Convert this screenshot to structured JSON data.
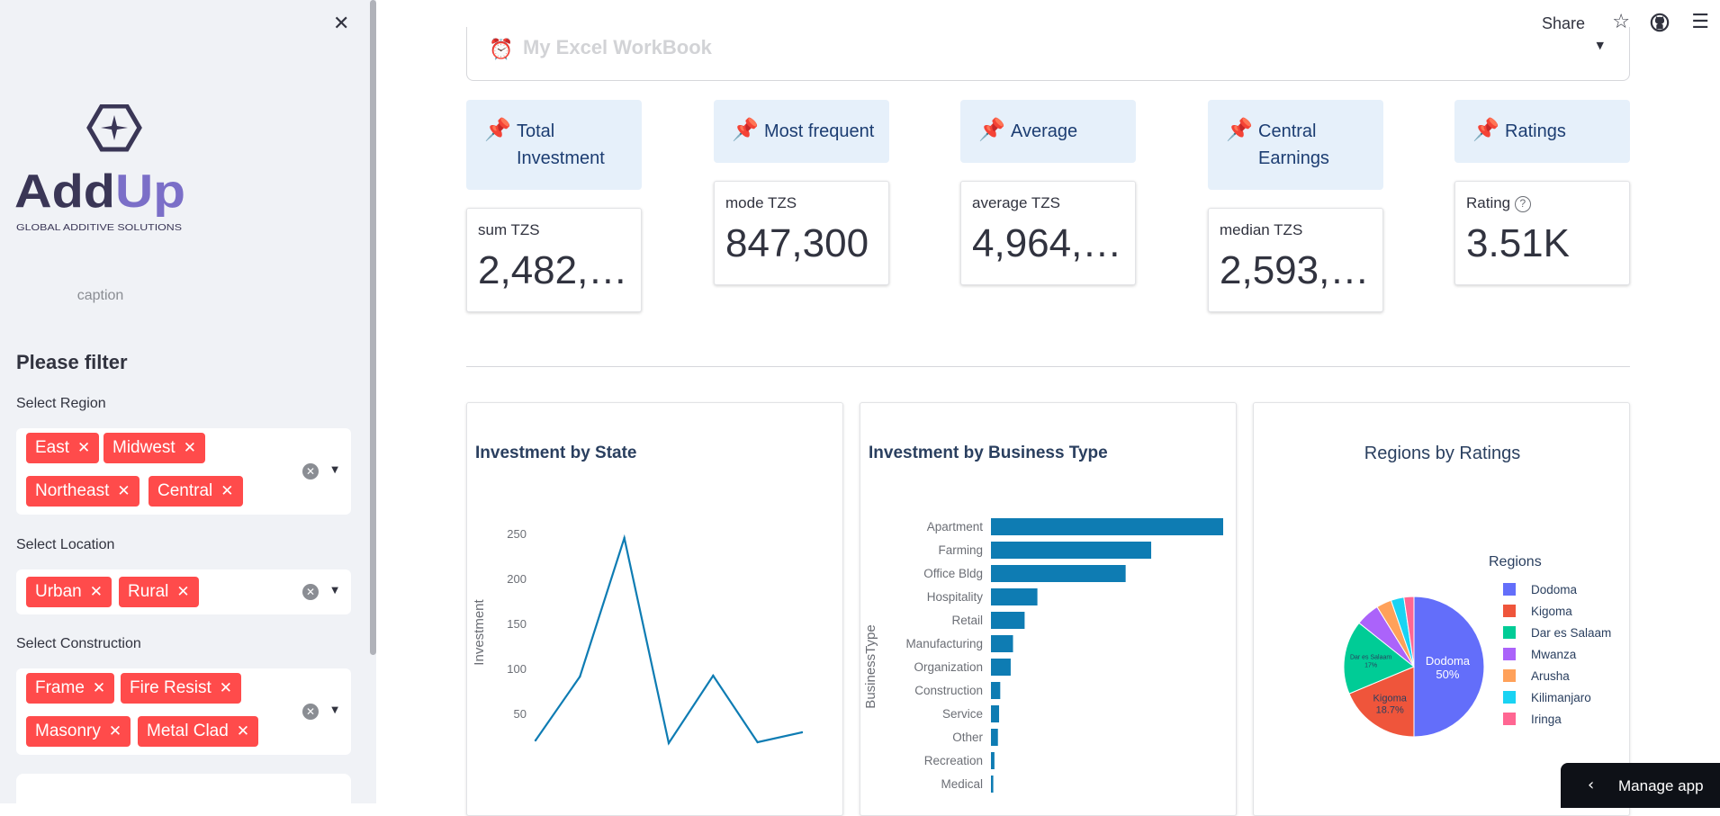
{
  "sidebar": {
    "close_icon": "close-icon",
    "logo": {
      "name": "AddUp",
      "tagline": "GLOBAL ADDITIVE SOLUTIONS",
      "accent": "#7b6fc8",
      "dark": "#3a3656"
    },
    "caption": "caption",
    "filter_heading": "Please filter",
    "filters": [
      {
        "label": "Select Region",
        "chips": [
          "East",
          "Midwest",
          "Northeast",
          "Central"
        ]
      },
      {
        "label": "Select Location",
        "chips": [
          "Urban",
          "Rural"
        ]
      },
      {
        "label": "Select Construction",
        "chips": [
          "Frame",
          "Fire Resist",
          "Masonry",
          "Metal Clad"
        ]
      }
    ],
    "chip_color": "#ff4b4b"
  },
  "topbar": {
    "share_label": "Share",
    "star_icon": "star-icon",
    "github_icon": "github-icon",
    "menu_icon": "hamburger-menu-icon"
  },
  "workbook_select": {
    "value": "My Excel WorkBook",
    "icon": "alarm-clock-icon"
  },
  "kpis": [
    {
      "heading": "Total Investment",
      "label": "sum TZS",
      "value": "2,482,…"
    },
    {
      "heading": "Most frequent",
      "label": "mode TZS",
      "value": "847,300"
    },
    {
      "heading": "Average",
      "label": "average TZS",
      "value": "4,964,…"
    },
    {
      "heading": "Central Earnings",
      "label": "median TZS",
      "value": "2,593,…"
    },
    {
      "heading": "Ratings",
      "label": "Rating",
      "value": "3.51K",
      "help_icon": "question-circle-icon"
    }
  ],
  "kpi_icon": "pushpin-icon",
  "charts": {
    "line": {
      "title": "Investment by State",
      "ylabel": "Investment"
    },
    "bar": {
      "title": "Investment by Business Type",
      "ylabel": "BusinessType"
    },
    "pie": {
      "title": "Regions by Ratings",
      "legend_title": "Regions"
    }
  },
  "chart_data": [
    {
      "type": "line",
      "title": "Investment by State",
      "xlabel": "",
      "ylabel": "Investment",
      "ticks_y": [
        50,
        100,
        150,
        200,
        250
      ],
      "ylim": [
        10,
        270
      ],
      "x": [
        0,
        1,
        2,
        3,
        4,
        5,
        6
      ],
      "values": [
        20,
        91,
        245,
        17,
        92,
        18,
        29
      ],
      "color": "#0e7cb3"
    },
    {
      "type": "bar",
      "orientation": "horizontal",
      "title": "Investment by Business Type",
      "ylabel": "BusinessType",
      "categories": [
        "Apartment",
        "Farming",
        "Office Bldg",
        "Hospitality",
        "Retail",
        "Manufacturing",
        "Organization",
        "Construction",
        "Service",
        "Other",
        "Recreation",
        "Medical"
      ],
      "values": [
        100,
        69,
        58,
        20,
        14.5,
        9.5,
        8.5,
        4,
        3.5,
        3,
        1.5,
        1
      ],
      "xlim": [
        0,
        100
      ],
      "color": "#0e7cb3"
    },
    {
      "type": "pie",
      "title": "Regions by Ratings",
      "legend_title": "Regions",
      "legend_position": "right",
      "labels": [
        "Dodoma",
        "Kigoma",
        "Dar es Salaam",
        "Mwanza",
        "Arusha",
        "Kilimanjaro",
        "Iringa"
      ],
      "values": [
        50,
        18.7,
        17,
        5.5,
        3.5,
        3,
        2.3
      ],
      "colors": [
        "#636efa",
        "#ef553b",
        "#00cc96",
        "#ab63fa",
        "#ffa15a",
        "#19d3f3",
        "#ff6692"
      ],
      "slice_labels": {
        "Dodoma": [
          "Dodoma",
          "50%"
        ],
        "Kigoma": [
          "Kigoma",
          "18.7%"
        ],
        "Dar es Salaam": [
          "Dar es Salaam",
          "17%"
        ]
      }
    }
  ],
  "manage_app": {
    "label": "Manage app",
    "icon": "chevron-left-icon"
  }
}
